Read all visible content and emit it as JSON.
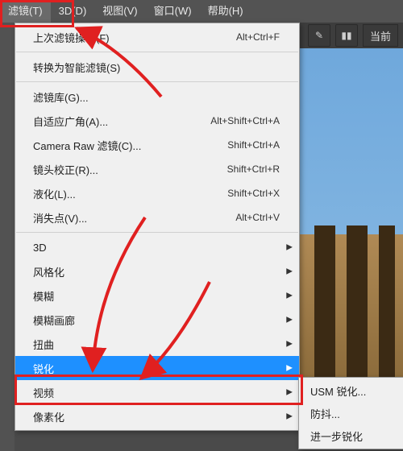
{
  "menubar": {
    "filter": "滤镜(T)",
    "three_d": "3D(D)",
    "view": "视图(V)",
    "window": "窗口(W)",
    "help": "帮助(H)"
  },
  "toolbar_right": {
    "current_tab": "当前"
  },
  "menu": {
    "last_filter": "上次滤镜操作(F)",
    "last_filter_scut": "Alt+Ctrl+F",
    "convert_smart": "转换为智能滤镜(S)",
    "filter_gallery": "滤镜库(G)...",
    "adaptive_wide": "自适应广角(A)...",
    "adaptive_wide_scut": "Alt+Shift+Ctrl+A",
    "camera_raw": "Camera Raw 滤镜(C)...",
    "camera_raw_scut": "Shift+Ctrl+A",
    "lens_corr": "镜头校正(R)...",
    "lens_corr_scut": "Shift+Ctrl+R",
    "liquify": "液化(L)...",
    "liquify_scut": "Shift+Ctrl+X",
    "vanishing": "消失点(V)...",
    "vanishing_scut": "Alt+Ctrl+V",
    "three_d": "3D",
    "stylize": "风格化",
    "blur": "模糊",
    "blur_gallery": "模糊画廊",
    "distort": "扭曲",
    "sharpen": "锐化",
    "video": "视频",
    "pixelate": "像素化"
  },
  "submenu": {
    "usm": "USM 锐化...",
    "shake": "防抖...",
    "further": "进一步锐化"
  },
  "colors": {
    "annotation_red": "#e02020",
    "highlight_blue": "#1e90ff"
  }
}
